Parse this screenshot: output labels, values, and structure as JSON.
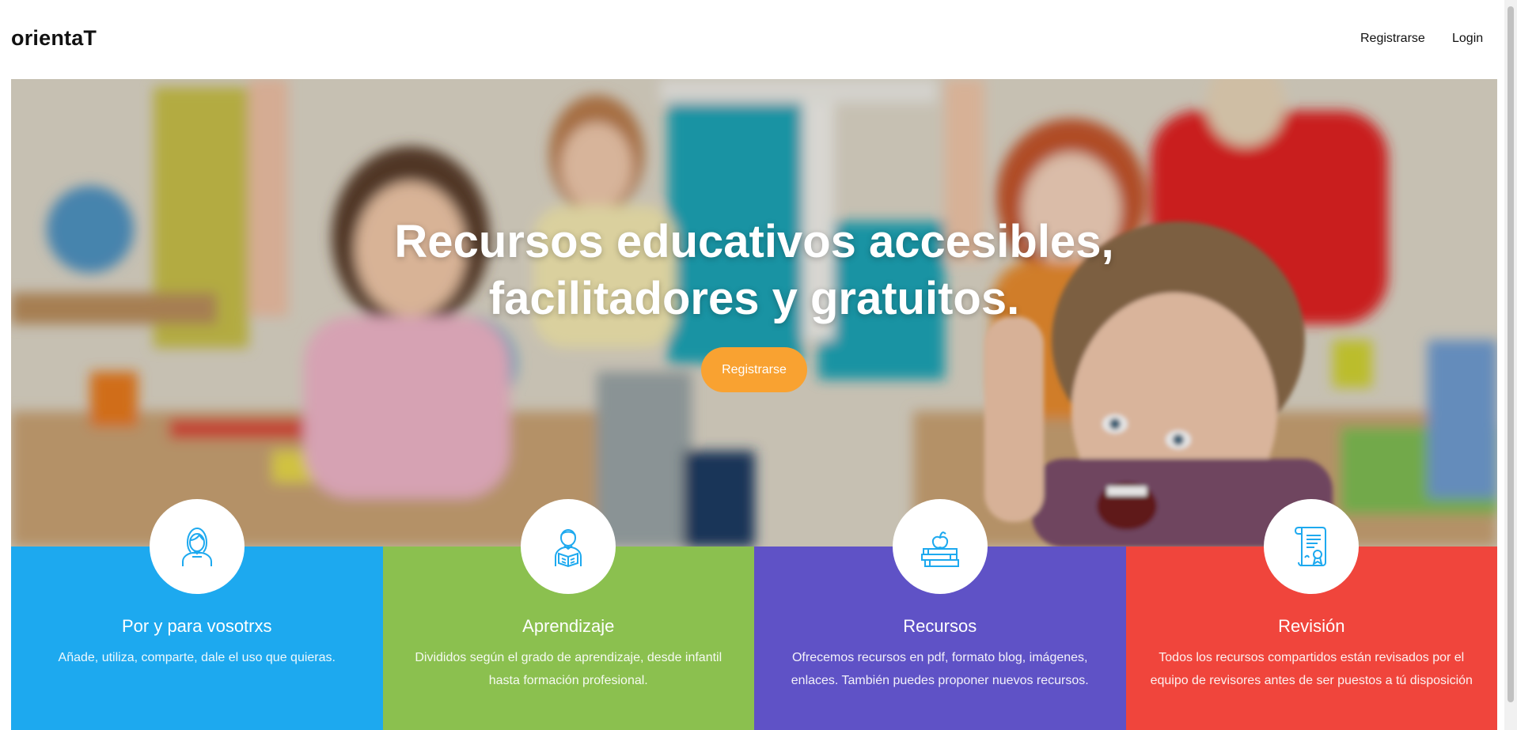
{
  "header": {
    "brand": "orientaT",
    "nav": {
      "register": "Registrarse",
      "login": "Login"
    }
  },
  "hero": {
    "title_line1": "Recursos educativos accesibles,",
    "title_line2": "facilitadores y gratuitos.",
    "cta": "Registrarse"
  },
  "features": [
    {
      "icon": "teacher-icon",
      "title": "Por y para vosotrxs",
      "desc": "Añade, utiliza, comparte, dale el uso que quieras.",
      "color": "#1da9ef"
    },
    {
      "icon": "student-reading-icon",
      "title": "Aprendizaje",
      "desc": "Divididos según el grado de aprendizaje, desde infantil hasta formación profesional.",
      "color": "#8bc04f"
    },
    {
      "icon": "books-apple-icon",
      "title": "Recursos",
      "desc": "Ofrecemos recursos en pdf, formato blog, imágenes, enlaces. También puedes proponer nuevos recursos.",
      "color": "#5f52c6"
    },
    {
      "icon": "certificate-icon",
      "title": "Revisión",
      "desc": "Todos los recursos compartidos están revisados por el equipo de revisores antes de ser puestos a tú disposición",
      "color": "#f0453c"
    }
  ],
  "theme": {
    "cta_color": "#f9a231",
    "icon_color": "#1da9ef"
  }
}
